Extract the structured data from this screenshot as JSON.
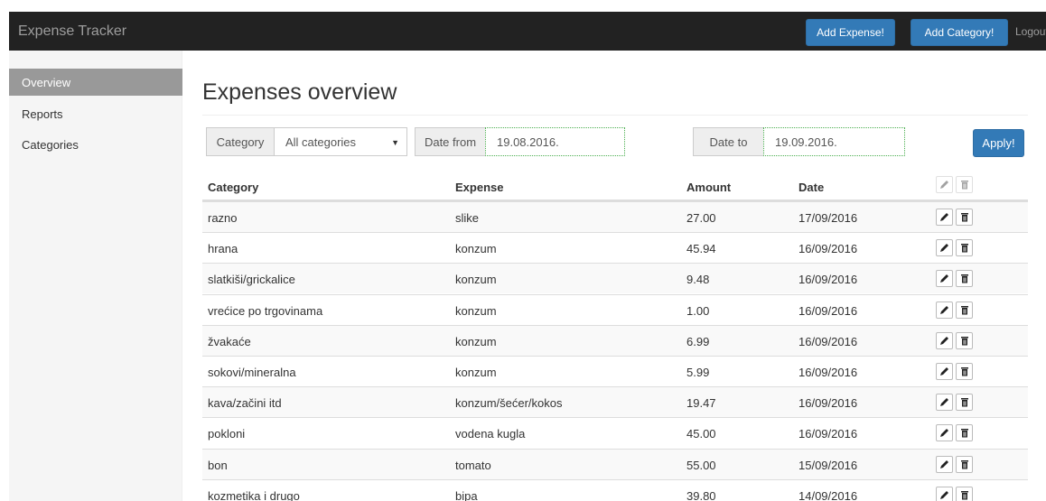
{
  "navbar": {
    "brand": "Expense Tracker",
    "add_expense_label": "Add Expense!",
    "add_category_label": "Add Category!",
    "logout_label": "Logout"
  },
  "sidebar": {
    "items": [
      {
        "label": "Overview",
        "active": true
      },
      {
        "label": "Reports",
        "active": false
      },
      {
        "label": "Categories",
        "active": false
      }
    ]
  },
  "main": {
    "title": "Expenses overview",
    "filters": {
      "category_label": "Category",
      "category_value": "All categories",
      "date_from_label": "Date from",
      "date_from_value": "19.08.2016.",
      "date_to_label": "Date to",
      "date_to_value": "19.09.2016.",
      "apply_label": "Apply!"
    },
    "table": {
      "headers": [
        "Category",
        "Expense",
        "Amount",
        "Date"
      ],
      "rows": [
        [
          "razno",
          "slike",
          "27.00",
          "17/09/2016"
        ],
        [
          "hrana",
          "konzum",
          "45.94",
          "16/09/2016"
        ],
        [
          "slatkiši/grickalice",
          "konzum",
          "9.48",
          "16/09/2016"
        ],
        [
          "vrećice po trgovinama",
          "konzum",
          "1.00",
          "16/09/2016"
        ],
        [
          "žvakaće",
          "konzum",
          "6.99",
          "16/09/2016"
        ],
        [
          "sokovi/mineralna",
          "konzum",
          "5.99",
          "16/09/2016"
        ],
        [
          "kava/začini itd",
          "konzum/šećer/kokos",
          "19.47",
          "16/09/2016"
        ],
        [
          "pokloni",
          "vodena kugla",
          "45.00",
          "16/09/2016"
        ],
        [
          "bon",
          "tomato",
          "55.00",
          "15/09/2016"
        ],
        [
          "kozmetika i drugo",
          "bipa",
          "39.80",
          "14/09/2016"
        ]
      ]
    }
  },
  "colors": {
    "navbar_bg": "#222222",
    "primary": "#337ab7",
    "sidebar_active": "#999999",
    "date_field_border": "#4caf50"
  },
  "icons": {
    "edit": "pencil-icon",
    "delete": "trash-icon",
    "dropdown": "caret-down-icon"
  }
}
